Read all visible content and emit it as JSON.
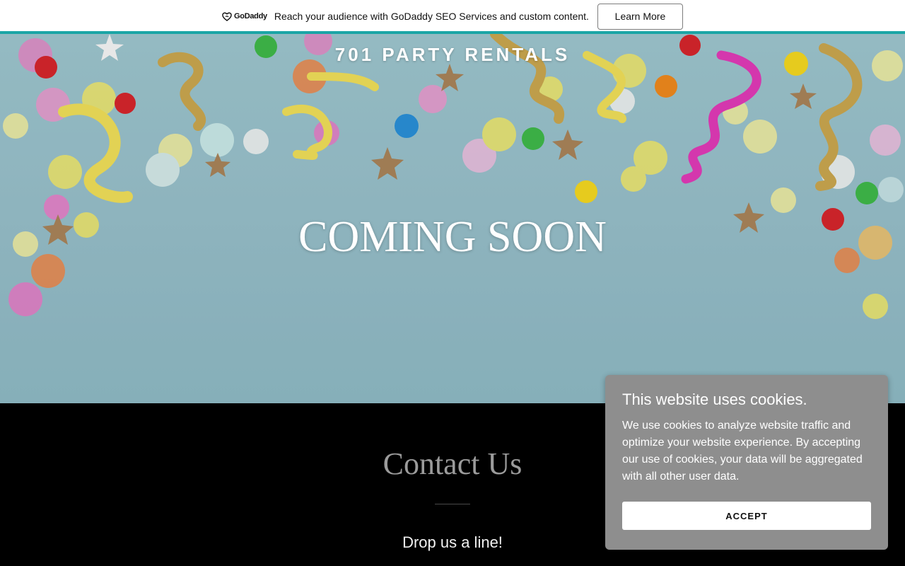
{
  "promo": {
    "logo_text": "GoDaddy",
    "message": "Reach your audience with GoDaddy SEO Services and custom content.",
    "button_label": "Learn More",
    "accent_color": "#1ba5a6"
  },
  "hero": {
    "site_title": "701 PARTY RENTALS",
    "headline": "COMING SOON"
  },
  "contact": {
    "heading": "Contact Us",
    "subheading": "Drop us a line!"
  },
  "cookie_banner": {
    "title": "This website uses cookies.",
    "body": "We use cookies to analyze website traffic and optimize your website experience. By accepting our use of cookies, your data will be aggregated with all other user data.",
    "accept_label": "ACCEPT"
  }
}
